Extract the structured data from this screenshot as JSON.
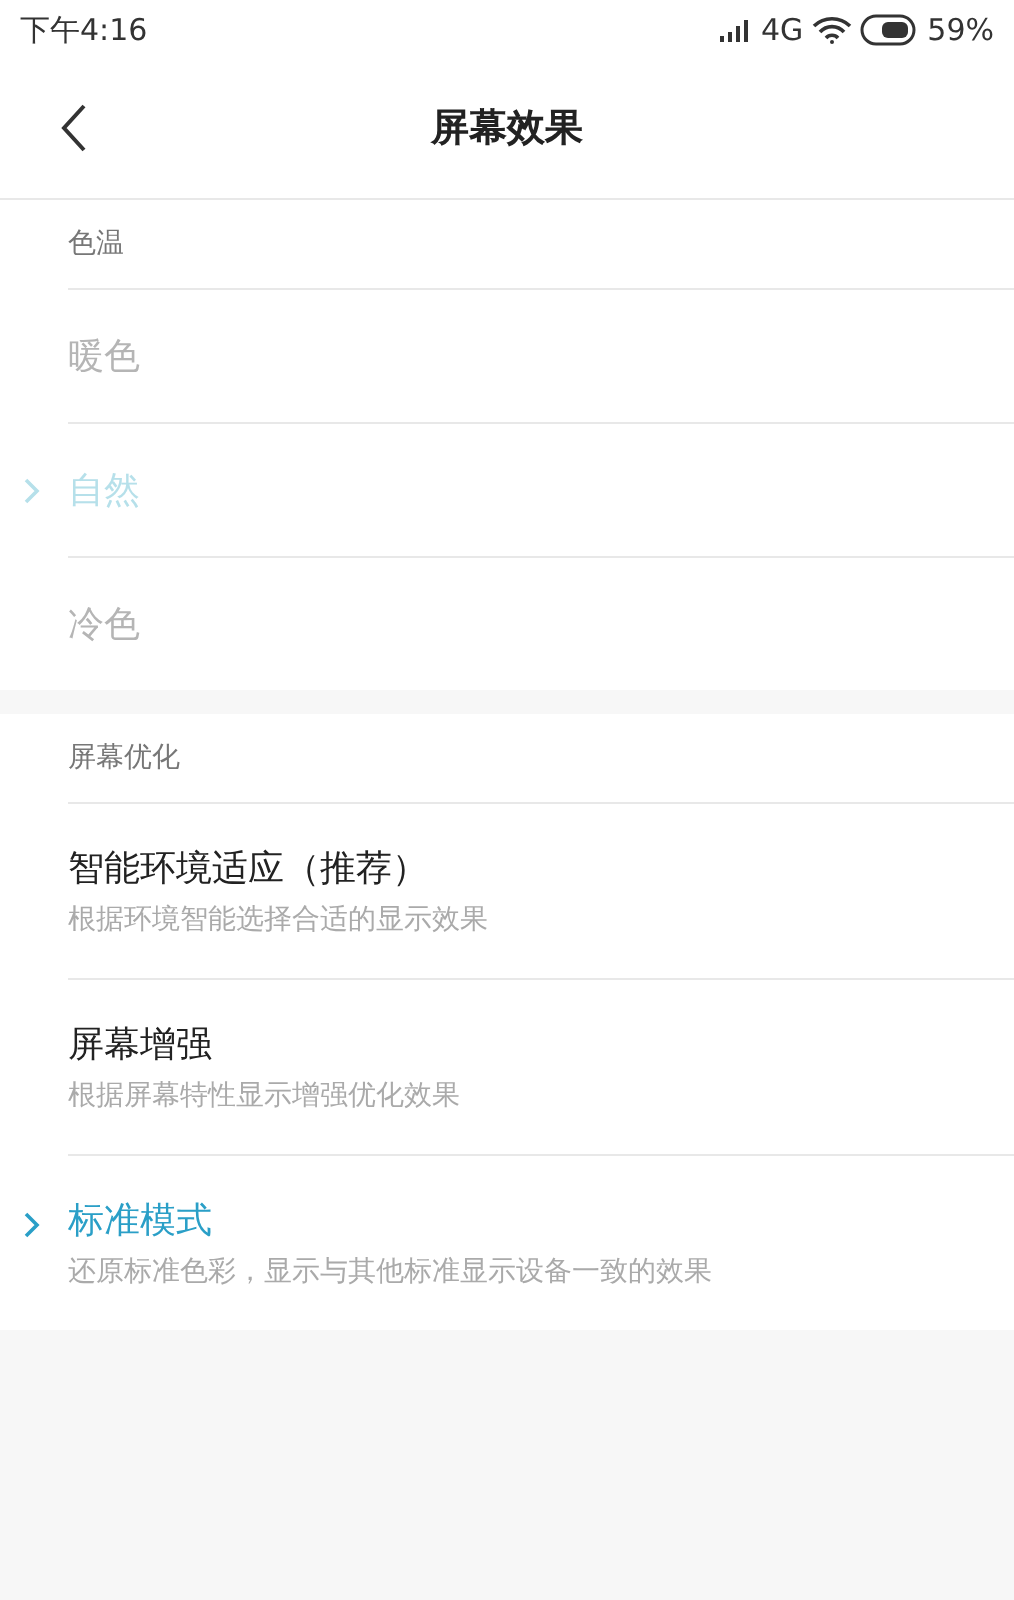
{
  "status_bar": {
    "time": "下午4:16",
    "network": "4G",
    "battery": "59%"
  },
  "header": {
    "title": "屏幕效果"
  },
  "sections": [
    {
      "title": "色温",
      "disabled": true,
      "items": [
        {
          "title": "暖色",
          "selected": false
        },
        {
          "title": "自然",
          "selected": true
        },
        {
          "title": "冷色",
          "selected": false
        }
      ]
    },
    {
      "title": "屏幕优化",
      "disabled": false,
      "items": [
        {
          "title": "智能环境适应（推荐）",
          "subtitle": "根据环境智能选择合适的显示效果",
          "selected": false
        },
        {
          "title": "屏幕增强",
          "subtitle": "根据屏幕特性显示增强优化效果",
          "selected": false
        },
        {
          "title": "标准模式",
          "subtitle": "还原标准色彩，显示与其他标准显示设备一致的效果",
          "selected": true
        }
      ]
    }
  ]
}
